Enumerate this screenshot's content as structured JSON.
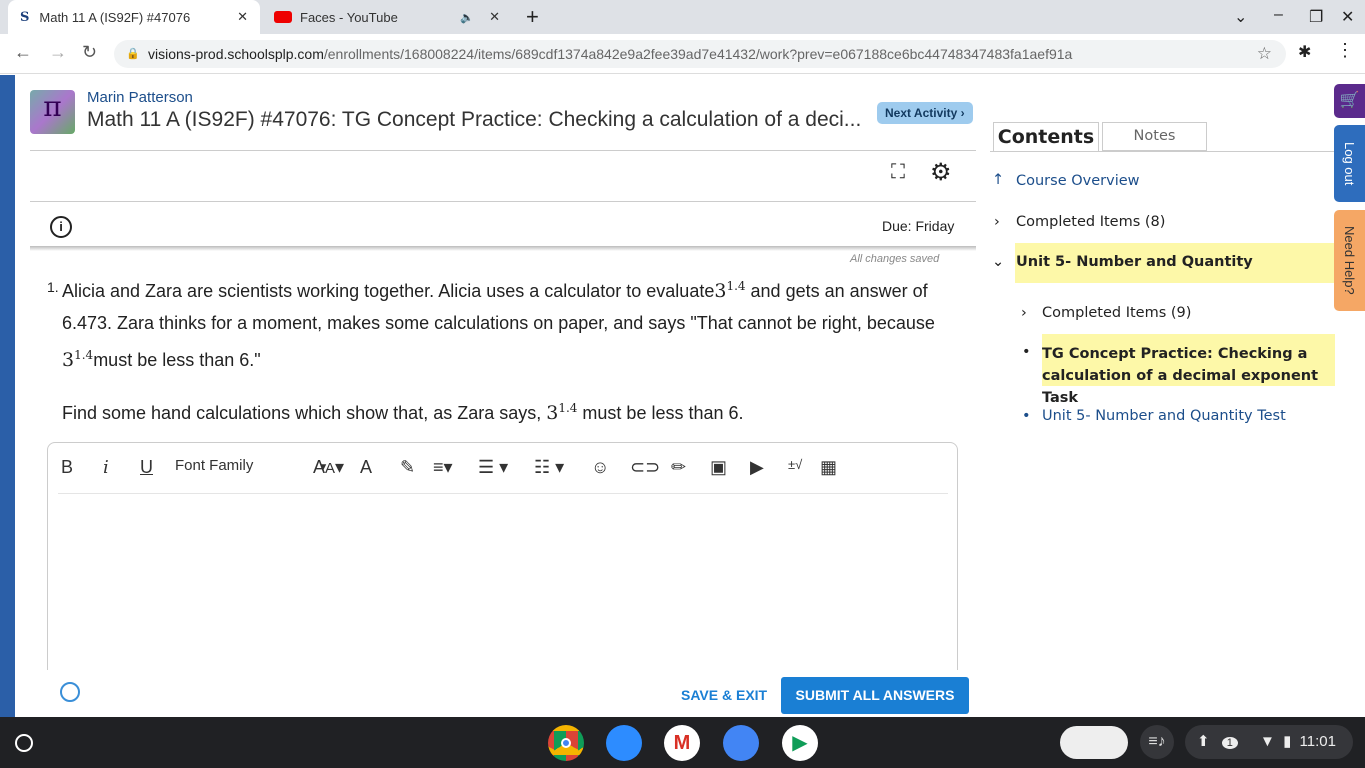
{
  "browser": {
    "tabs": [
      {
        "title": "Math 11 A (IS92F) #47076",
        "active": true
      },
      {
        "title": "Faces - YouTube",
        "active": false,
        "audio": true
      }
    ],
    "url_domain": "visions-prod.schoolsplp.com",
    "url_path": "/enrollments/168008224/items/689cdf1374a842e9a2fee39ad7e41432/work?prev=e067188ce6bc44748347483fa1aef91a"
  },
  "header": {
    "student": "Marin Patterson",
    "title": "Math 11 A (IS92F) #47076: TG Concept Practice: Checking a calculation of a deci...",
    "next_label": "Next Activity ›"
  },
  "assignment": {
    "due": "Due: Friday",
    "save_status": "All changes saved",
    "question_number": "1.",
    "q_part1": "Alicia and Zara are scientists working together. Alicia uses a calculator to evaluate",
    "base": "3",
    "exponent": "1.4",
    "q_part2": " and gets an answer of 6.473. Zara thinks for a moment, makes some calculations on paper, and says \"That cannot be right, because ",
    "q_part3": "must be less than 6.\"",
    "q2_part1": "Find some hand calculations which show that, as Zara says, ",
    "q2_part2": " must be less than 6."
  },
  "editor": {
    "font_family": "Font Family"
  },
  "footer": {
    "save_exit": "SAVE & EXIT",
    "submit": "SUBMIT ALL ANSWERS"
  },
  "sidebar": {
    "tabs": [
      "Contents",
      "Notes"
    ],
    "course_overview": "Course Overview",
    "completed1": "Completed Items (8)",
    "unit": "Unit 5- Number and Quantity",
    "completed2": "Completed Items (9)",
    "current": "TG Concept Practice: Checking a calculation of a decimal exponent Task",
    "test": "Unit 5- Number and Quantity Test"
  },
  "side_tabs": {
    "logout": "Log out",
    "help": "Need Help?"
  },
  "taskbar": {
    "time": "11:01",
    "notifications": "1"
  },
  "colors": {
    "accent": "#1a7fd4",
    "highlight": "#fdf8a8",
    "link": "#1c4e8b"
  }
}
